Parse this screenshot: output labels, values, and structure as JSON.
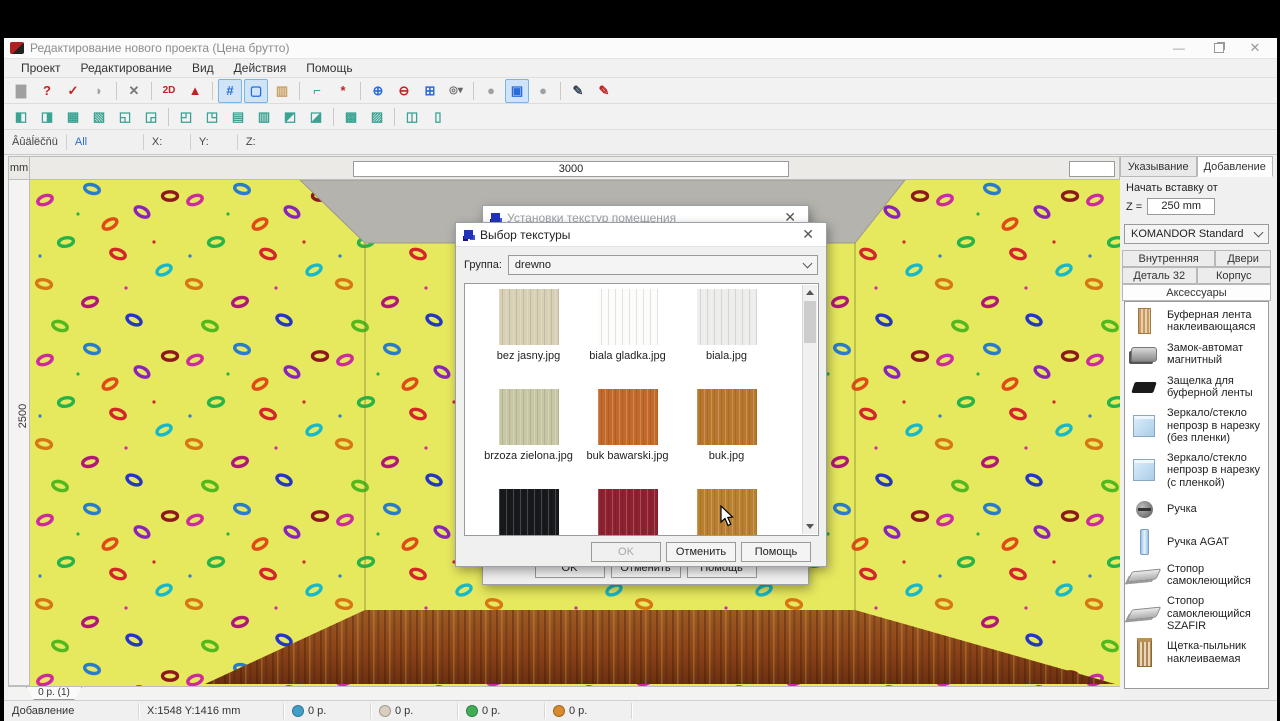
{
  "window": {
    "title": "Редактирование нового проекта (Цена брутто)"
  },
  "menu": {
    "items": [
      "Проект",
      "Редактирование",
      "Вид",
      "Действия",
      "Помощь"
    ]
  },
  "toolbars": {
    "main": [
      {
        "name": "save-icon",
        "glyph": "▇",
        "color": "#a0a0a0"
      },
      {
        "name": "new-project-icon",
        "glyph": "?",
        "color": "#c22222"
      },
      {
        "name": "open-project-icon",
        "glyph": "✓",
        "color": "#c22222"
      },
      {
        "name": "fill-icon",
        "glyph": "◗",
        "color": "#a0a0a0"
      },
      {
        "name": "sep"
      },
      {
        "name": "delete-icon",
        "glyph": "✕",
        "color": "#777777"
      },
      {
        "name": "sep"
      },
      {
        "name": "2d-view-icon",
        "glyph": "2D",
        "color": "#c22222"
      },
      {
        "name": "3d-view-icon",
        "glyph": "▲",
        "color": "#c22222"
      },
      {
        "name": "sep"
      },
      {
        "name": "grid-icon",
        "glyph": "#",
        "color": "#2a6cd8",
        "active": true
      },
      {
        "name": "walls-icon",
        "glyph": "▢",
        "color": "#2a6cd8",
        "active": true
      },
      {
        "name": "door-icon",
        "glyph": "▥",
        "color": "#c8a060"
      },
      {
        "name": "sep"
      },
      {
        "name": "corner-icon",
        "glyph": "⌐",
        "color": "#1a9a8a"
      },
      {
        "name": "axes-icon",
        "glyph": "*",
        "color": "#c22222"
      },
      {
        "name": "sep"
      },
      {
        "name": "zoom-in-icon",
        "glyph": "⊕",
        "color": "#2a6cd8"
      },
      {
        "name": "zoom-out-icon",
        "glyph": "⊖",
        "color": "#c22222"
      },
      {
        "name": "zoom-fit-icon",
        "glyph": "⊞",
        "color": "#2a6cd8"
      },
      {
        "name": "zoom-menu-icon",
        "glyph": "◎▾",
        "color": "#666666"
      },
      {
        "name": "sep"
      },
      {
        "name": "render-icon",
        "glyph": "●",
        "color": "#a0a0a0"
      },
      {
        "name": "copy-style-icon",
        "glyph": "▣",
        "color": "#2a6cd8",
        "active": true
      },
      {
        "name": "sphere-icon",
        "glyph": "●",
        "color": "#a0a0a0"
      },
      {
        "name": "sep"
      },
      {
        "name": "pen-add-icon",
        "glyph": "✎",
        "color": "#334455"
      },
      {
        "name": "pen-remove-icon",
        "glyph": "✎",
        "color": "#c22222"
      }
    ],
    "align": [
      {
        "name": "elem-align-left-icon",
        "glyph": "◧"
      },
      {
        "name": "elem-align-right-icon",
        "glyph": "◨"
      },
      {
        "name": "elem-align-top-icon",
        "glyph": "▦"
      },
      {
        "name": "elem-align-bottom-icon",
        "glyph": "▧"
      },
      {
        "name": "elem-rotate-icon",
        "glyph": "◱"
      },
      {
        "name": "elem-move-icon",
        "glyph": "◲"
      },
      {
        "name": "sep"
      },
      {
        "name": "group-align-left-icon",
        "glyph": "◰"
      },
      {
        "name": "group-align-right-icon",
        "glyph": "◳"
      },
      {
        "name": "group-align-top-icon",
        "glyph": "▤"
      },
      {
        "name": "group-align-bottom-icon",
        "glyph": "▥"
      },
      {
        "name": "group-rotate-icon",
        "glyph": "◩"
      },
      {
        "name": "group-move-icon",
        "glyph": "◪"
      },
      {
        "name": "sep"
      },
      {
        "name": "spacing-h-icon",
        "glyph": "▩"
      },
      {
        "name": "spacing-v-icon",
        "glyph": "▨"
      },
      {
        "name": "sep"
      },
      {
        "name": "center-h-icon",
        "glyph": "◫"
      },
      {
        "name": "center-v-icon",
        "glyph": "▯"
      }
    ]
  },
  "filter_bar": {
    "label": "Âûäĺëčňü",
    "scope": "All",
    "x_label": "X:",
    "y_label": "Y:",
    "z_label": "Z:"
  },
  "rulers": {
    "unit": "mm",
    "width": "3000",
    "height": "2500"
  },
  "viewport": {
    "price_tab": "0 р. (1)"
  },
  "right_panel": {
    "tabs": [
      "Указывание",
      "Добавление"
    ],
    "insert_label": "Начать вставку от",
    "z_label": "Z =",
    "z_value": "250 mm",
    "system": "KOMANDOR Standard",
    "category_tabs": [
      "Внутренняя часть",
      "Двери",
      "Деталь 32",
      "Корпус",
      "Аксессуары"
    ],
    "accessories": [
      {
        "label": "Буферная лента наклеивающаяся",
        "icon": "tape-brush-icon"
      },
      {
        "label": "Замок-автомат магнитный",
        "icon": "magnetic-lock-icon"
      },
      {
        "label": "Защелка для буферной ленты",
        "icon": "latch-icon"
      },
      {
        "label": "Зеркало/стекло непрозр в нарезку (без пленки)",
        "icon": "glass-icon"
      },
      {
        "label": "Зеркало/стекло непрозр в нарезку (с пленкой)",
        "icon": "glass-icon"
      },
      {
        "label": "Ручка",
        "icon": "handle-icon"
      },
      {
        "label": "Ручка AGAT",
        "icon": "handle-agat-icon"
      },
      {
        "label": "Стопор самоклеющийся",
        "icon": "stopper-icon"
      },
      {
        "label": "Стопор самоклеющийся SZAFIR",
        "icon": "stopper-icon"
      },
      {
        "label": "Щетка-пыльник наклеиваемая",
        "icon": "dust-brush-icon"
      }
    ]
  },
  "texture_settings_dialog": {
    "title": "Установки текстур помещения",
    "ok": "OK",
    "cancel": "Отменить",
    "help": "Помощь"
  },
  "texture_dialog": {
    "title": "Выбор текстуры",
    "group_label": "Группа:",
    "group_value": "drewno",
    "ok": "OK",
    "cancel": "Отменить",
    "help": "Помощь",
    "textures": [
      {
        "name": "bez jasny.jpg",
        "color": "#d7d0b5"
      },
      {
        "name": "biala gladka.jpg",
        "color": "#fcfcfa"
      },
      {
        "name": "biala.jpg",
        "color": "#ededeb"
      },
      {
        "name": "brzoza zielona.jpg",
        "color": "#c8c7a4"
      },
      {
        "name": "buk bawarski.jpg",
        "color": "#c3692b"
      },
      {
        "name": "buk.jpg",
        "color": "#b9772e"
      },
      {
        "name": "",
        "color": "#17191d"
      },
      {
        "name": "",
        "color": "#8e2130"
      },
      {
        "name": "",
        "color": "#b9812f"
      }
    ]
  },
  "status_bar": {
    "mode": "Добавление",
    "coords": "X:1548  Y:1416   mm",
    "prices": [
      {
        "value": "0 р.",
        "color": "#3f9fc6"
      },
      {
        "value": "0 р.",
        "color": "#d9cfc0"
      },
      {
        "value": "0 р.",
        "color": "#3fae57"
      },
      {
        "value": "0 р.",
        "color": "#d78a2e"
      }
    ]
  },
  "colors": {
    "wall": "#e6e85e",
    "ceiling": "#b5b3ae",
    "floor_dark": "#6b2f10",
    "floor_light": "#9c5a24",
    "highlight": "#cfe4f7"
  }
}
